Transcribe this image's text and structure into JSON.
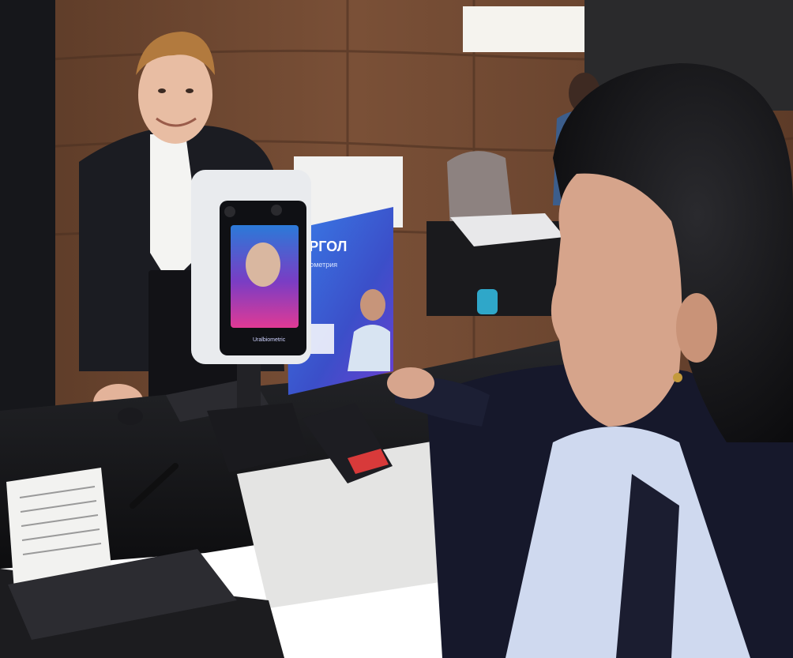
{
  "photo": {
    "standee": {
      "brand": "УРГОЛ",
      "subtitle": "биометрия"
    },
    "terminal": {
      "label": "Uralbiometric"
    },
    "colors": {
      "wall_wood": "#6b4630",
      "counter_black": "#141416",
      "terminal_white": "#e9ebee",
      "screen_pink": "#d23a92",
      "screen_purple": "#4b2a8c",
      "standee_blue": "#2f5ed6",
      "shirt_blue": "#cfd9ef"
    }
  }
}
